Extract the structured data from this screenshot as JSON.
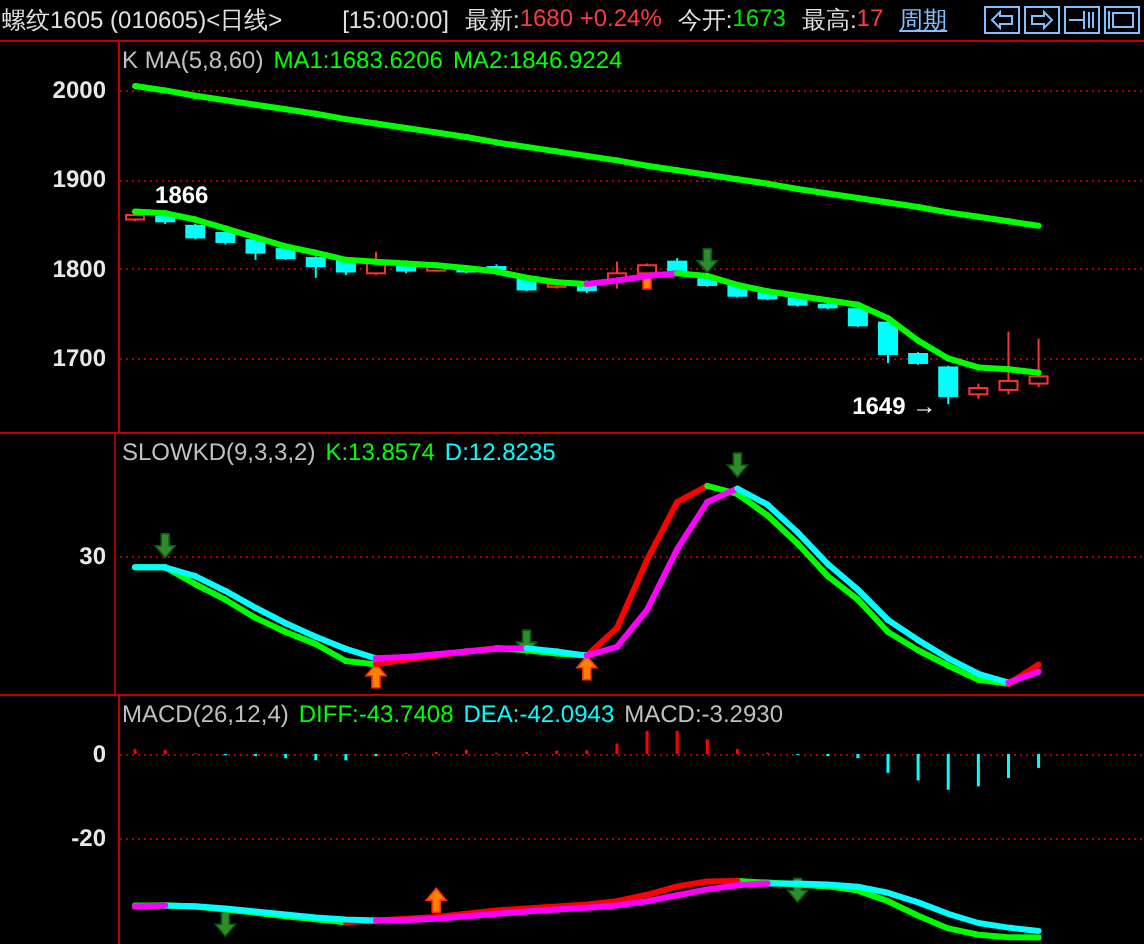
{
  "header": {
    "title": "螺纹1605 (010605)<日线>",
    "time": "[15:00:00]",
    "quotes": [
      {
        "label": "最新:",
        "value": "1680 +0.24%",
        "color": "#ff3c3c"
      },
      {
        "label": "今开:",
        "value": "1673",
        "color": "#00e600"
      },
      {
        "label": "最高:",
        "value": "17",
        "color": "#ff3c3c"
      }
    ],
    "link": "周期",
    "buttons": [
      {
        "kind": "left"
      },
      {
        "kind": "right"
      },
      {
        "kind": "split"
      },
      {
        "kind": "max"
      }
    ]
  },
  "panels": [
    {
      "kind": "price",
      "legend": [
        {
          "text": "MA1:1683.6206",
          "color": "#00ff00"
        },
        {
          "text": "MA2:1846.9224",
          "color": "#00ff00"
        }
      ],
      "chart_data": {
        "type": "candlestick",
        "title": "K  MA(5,8,60)",
        "categories": [
          null,
          null,
          null,
          null,
          null,
          null,
          null,
          null,
          null,
          null,
          null,
          null,
          null,
          null,
          null,
          null,
          null,
          null,
          null,
          null,
          null,
          null,
          null,
          null,
          null,
          null,
          null,
          null,
          null,
          null,
          null,
          null,
          null,
          null
        ],
        "ylim": [
          1618,
          2053
        ],
        "yticks": [
          1700,
          1800,
          1900,
          2000
        ],
        "grid": true,
        "ohlc": [
          [
            1855,
            1866,
            1853,
            1860
          ],
          [
            1858,
            1862,
            1850,
            1853
          ],
          [
            1848,
            1850,
            1833,
            1835
          ],
          [
            1840,
            1842,
            1827,
            1830
          ],
          [
            1832,
            1834,
            1810,
            1818
          ],
          [
            1822,
            1824,
            1810,
            1812
          ],
          [
            1812,
            1814,
            1790,
            1803
          ],
          [
            1810,
            1812,
            1793,
            1797
          ],
          [
            1795,
            1819,
            1793,
            1808
          ],
          [
            1803,
            1805,
            1795,
            1798
          ],
          [
            1798,
            1804,
            1797,
            1802
          ],
          [
            1800,
            1802,
            1795,
            1797
          ],
          [
            1802,
            1805,
            1798,
            1800
          ],
          [
            1790,
            1792,
            1775,
            1777
          ],
          [
            1780,
            1785,
            1778,
            1783
          ],
          [
            1785,
            1787,
            1773,
            1776
          ],
          [
            1787,
            1808,
            1778,
            1795
          ],
          [
            1795,
            1806,
            1793,
            1804
          ],
          [
            1808,
            1812,
            1796,
            1798
          ],
          [
            1790,
            1792,
            1780,
            1782
          ],
          [
            1782,
            1784,
            1768,
            1770
          ],
          [
            1773,
            1775,
            1765,
            1767
          ],
          [
            1768,
            1770,
            1758,
            1760
          ],
          [
            1760,
            1762,
            1755,
            1757
          ],
          [
            1755,
            1757,
            1735,
            1737
          ],
          [
            1740,
            1742,
            1695,
            1705
          ],
          [
            1705,
            1707,
            1693,
            1695
          ],
          [
            1690,
            1692,
            1649,
            1658
          ],
          [
            1660,
            1672,
            1655,
            1667
          ],
          [
            1665,
            1730,
            1660,
            1675
          ],
          [
            1672,
            1722,
            1668,
            1680
          ],
          null,
          null,
          null
        ],
        "annotations": [
          "1866",
          "1649 →"
        ]
      }
    },
    {
      "kind": "kd",
      "legend": [
        {
          "text": "SLOWKD(9,3,3,2)",
          "color": "#c0c0c0"
        },
        {
          "text": "K:13.8574",
          "color": "#00ff00"
        },
        {
          "text": "D:12.8235",
          "color": "#00ffff"
        }
      ],
      "y_axis_labels": [
        "30"
      ]
    },
    {
      "kind": "macd",
      "legend": [
        {
          "text": "MACD:-3.2930",
          "color": "#c0c0c0"
        }
      ],
      "chart_data": {
        "type": "line",
        "title": "MACD(26,12,4)",
        "categories": [
          null,
          null,
          null,
          null,
          null,
          null,
          null,
          null,
          null,
          null,
          null,
          null,
          null,
          null,
          null,
          null,
          null,
          null,
          null,
          null,
          null,
          null,
          null,
          null,
          null,
          null,
          null,
          null,
          null,
          null,
          null,
          null,
          null,
          null
        ],
        "ylim": [
          -45.2,
          13.8
        ],
        "yticks": [
          -20,
          0
        ],
        "grid": true,
        "series": [
          {
            "name": "DIFF:-43.7408",
            "color": "#00ff00",
            "values": [
              -36,
              -36,
              -36.3,
              -37,
              -37.8,
              -38.6,
              -39.3,
              -40,
              null,
              null,
              null,
              null,
              null,
              null,
              null,
              null,
              null,
              null,
              null,
              null,
              -30.2,
              -30.6,
              -31,
              -31.5,
              -32.5,
              -35,
              -38.5,
              -41.5,
              -43,
              -43.6,
              -43.7,
              null,
              null,
              null
            ]
          },
          {
            "color": "#ff0000",
            "values": [
              null,
              null,
              null,
              null,
              null,
              null,
              null,
              -40,
              -39.6,
              -39.2,
              -38.8,
              -38,
              -37.2,
              -36.8,
              -36.3,
              -35.8,
              -35,
              -33.5,
              -31.5,
              -30.3,
              -30.2,
              null,
              null,
              null,
              null,
              null,
              null,
              null,
              null,
              null,
              null,
              null,
              null,
              null
            ]
          },
          {
            "name": "DEA:-42.0943",
            "color": "#00ffff",
            "values": [
              null,
              -36,
              -36.2,
              -36.8,
              -37.5,
              -38.2,
              -38.9,
              -39.4,
              -39.6,
              null,
              null,
              null,
              null,
              null,
              null,
              null,
              null,
              null,
              null,
              null,
              null,
              -30.8,
              -30.8,
              -31,
              -31.6,
              -33,
              -35.3,
              -38,
              -40.2,
              -41.3,
              -42.1,
              null,
              null,
              null
            ]
          },
          {
            "color": "#ff00ff",
            "values": [
              -36.3,
              -36,
              null,
              null,
              null,
              null,
              null,
              null,
              -39.6,
              -39.5,
              -39.2,
              -38.6,
              -38,
              -37.5,
              -37,
              -36.6,
              -36,
              -35,
              -33.6,
              -32.2,
              -31.2,
              -30.8,
              null,
              null,
              null,
              null,
              null,
              null,
              null,
              null,
              null,
              null,
              null,
              null
            ]
          }
        ]
      }
    }
  ]
}
